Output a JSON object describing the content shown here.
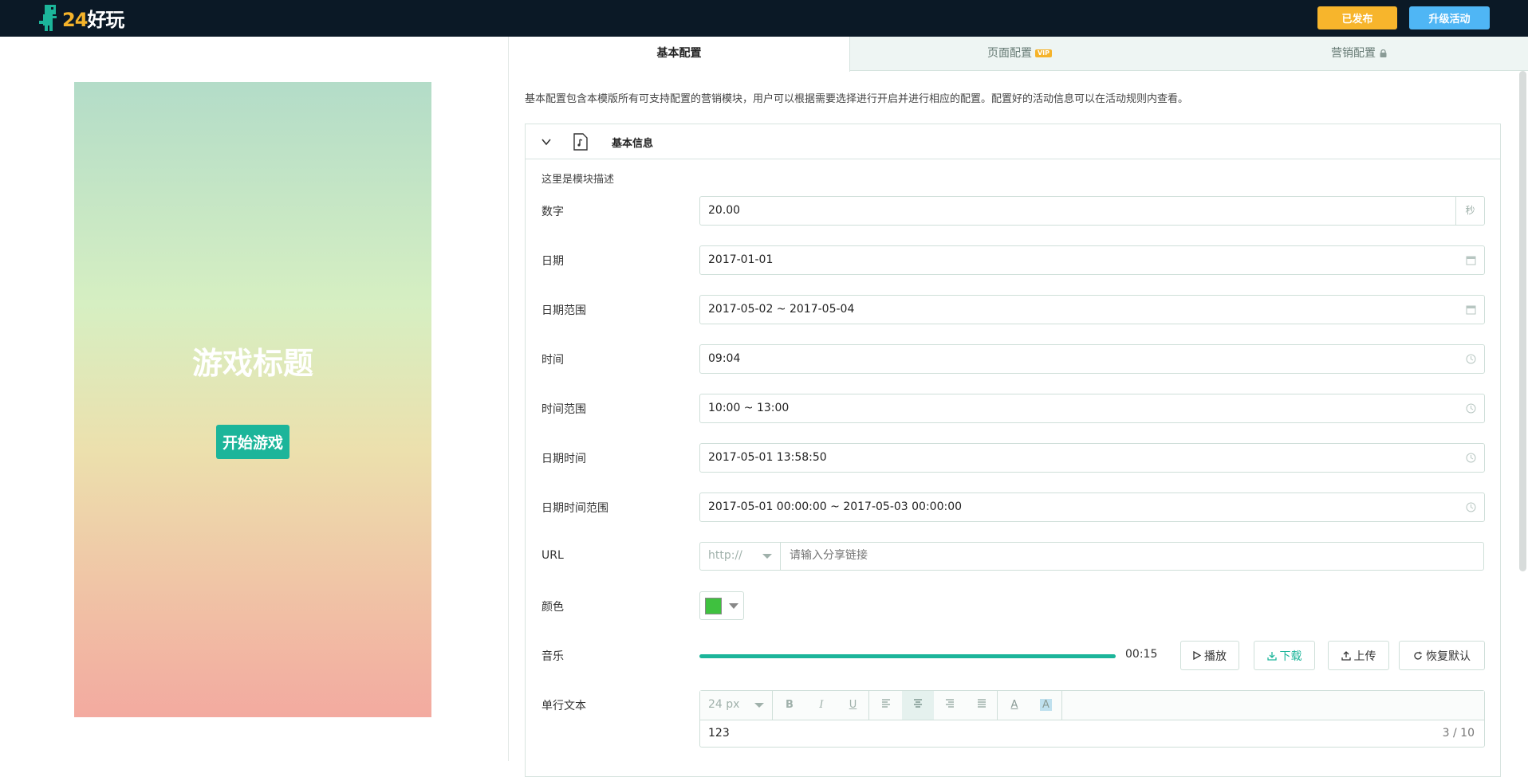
{
  "header": {
    "logo_number": "24",
    "logo_text": "好玩",
    "published_label": "已发布",
    "upgrade_label": "升级活动"
  },
  "preview": {
    "game_title": "游戏标题",
    "start_label": "开始游戏"
  },
  "tabs": [
    {
      "label": "基本配置",
      "active": true
    },
    {
      "label": "页面配置",
      "badge": "VIP"
    },
    {
      "label": "营销配置",
      "icon": "lock-icon"
    }
  ],
  "description": "基本配置包含本模版所有可支持配置的营销模块，用户可以根据需要选择进行开启并进行相应的配置。配置好的活动信息可以在活动规则内查看。",
  "section": {
    "title": "基本信息",
    "module_desc": "这里是模块描述",
    "fields": {
      "number": {
        "label": "数字",
        "value": "20.00",
        "suffix": "秒"
      },
      "date": {
        "label": "日期",
        "value": "2017-01-01"
      },
      "date_range": {
        "label": "日期范围",
        "value": "2017-05-02 ~ 2017-05-04"
      },
      "time": {
        "label": "时间",
        "value": "09:04"
      },
      "time_range": {
        "label": "时间范围",
        "value": "10:00 ~ 13:00"
      },
      "datetime": {
        "label": "日期时间",
        "value": "2017-05-01 13:58:50"
      },
      "datetime_range": {
        "label": "日期时间范围",
        "value": "2017-05-01 00:00:00 ~ 2017-05-03 00:00:00"
      },
      "url": {
        "label": "URL",
        "protocol": "http://",
        "placeholder": "请输入分享链接"
      },
      "color": {
        "label": "颜色",
        "value": "#3fc13f"
      },
      "music": {
        "label": "音乐",
        "time": "00:15",
        "progress": 1.0,
        "play": "播放",
        "download": "下载",
        "upload": "上传",
        "reset": "恢复默认"
      },
      "single_text": {
        "label": "单行文本",
        "font_size": "24 px",
        "value": "123",
        "count": "3 / 10"
      }
    }
  },
  "colors": {
    "accent": "#1cb59a",
    "published": "#f7b52c",
    "upgrade": "#4fb6f5",
    "topbar": "#0b1926"
  }
}
